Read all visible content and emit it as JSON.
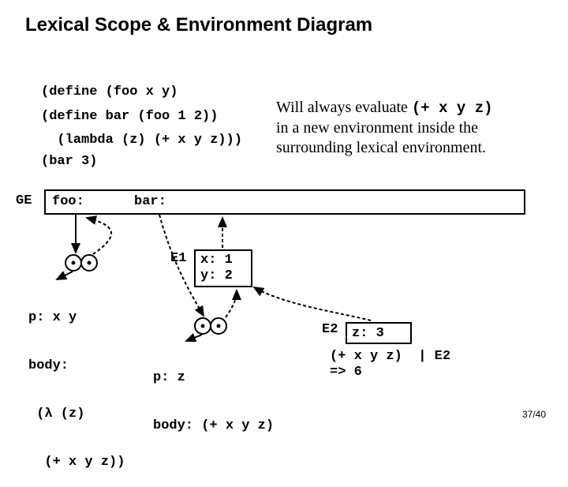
{
  "title": "Lexical Scope & Environment Diagram",
  "code": {
    "define_foo_l1": "(define (foo x y)",
    "define_foo_l2": "  (lambda (z) (+ x y z)))",
    "define_bar": "(define bar (foo 1 2))",
    "call_bar": "(bar 3)"
  },
  "note": {
    "l1_pre": "Will always evaluate ",
    "l1_code": "(+ x y z)",
    "l2": "in a new environment inside the",
    "l3": "surrounding lexical environment."
  },
  "ge_label": "GE",
  "ge": {
    "foo": "foo:",
    "bar": "bar:"
  },
  "closure_foo": {
    "p": "p: x y",
    "body_l1": "body:",
    "body_l2": " (λ (z)",
    "body_l3": "  (+ x y z))"
  },
  "e1": {
    "label": "E1",
    "x": "x: 1",
    "y": "y: 2"
  },
  "closure_bar": {
    "p": "p: z",
    "body": "body: (+ x y z)"
  },
  "e2": {
    "label": "E2",
    "z": "z: 3",
    "eval": "(+ x y z)  | E2",
    "result": "=> 6"
  },
  "pagenum": "37/40"
}
